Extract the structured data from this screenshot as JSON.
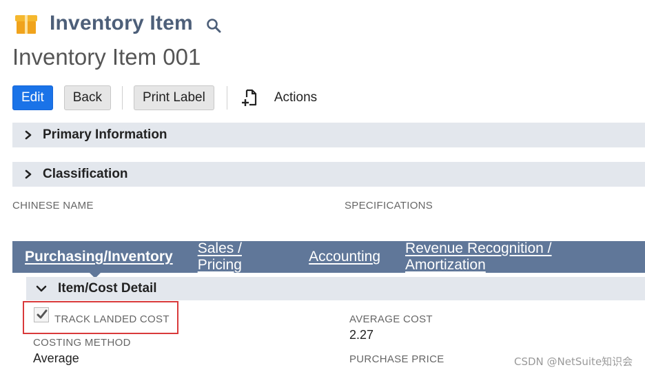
{
  "header": {
    "record_type": "Inventory Item",
    "icon": "box-icon",
    "search_icon": "search-icon"
  },
  "record": {
    "name": "Inventory Item 001"
  },
  "toolbar": {
    "edit_label": "Edit",
    "back_label": "Back",
    "print_label": "Print Label",
    "actions_label": "Actions"
  },
  "sections": {
    "primary_information": "Primary Information",
    "classification": "Classification"
  },
  "fields": {
    "chinese_name_label": "CHINESE NAME",
    "specifications_label": "SPECIFICATIONS"
  },
  "tabs": [
    {
      "label": "Purchasing/Inventory",
      "active": true
    },
    {
      "label": "Sales / Pricing",
      "active": false
    },
    {
      "label": "Accounting",
      "active": false
    },
    {
      "label": "Revenue Recognition / Amortization",
      "active": false
    }
  ],
  "item_cost_detail": {
    "title": "Item/Cost Detail",
    "track_landed_cost_label": "TRACK LANDED COST",
    "track_landed_cost_checked": true,
    "costing_method_label": "COSTING METHOD",
    "costing_method_value": "Average",
    "average_cost_label": "AVERAGE COST",
    "average_cost_value": "2.27",
    "purchase_price_label": "PURCHASE PRICE"
  },
  "colors": {
    "primary_button": "#1a73e8",
    "tab_bar": "#607799",
    "section_bar": "#e3e7ed",
    "title": "#4d5f79",
    "highlight": "#d9393a"
  },
  "watermark": "CSDN @NetSuite知识会"
}
